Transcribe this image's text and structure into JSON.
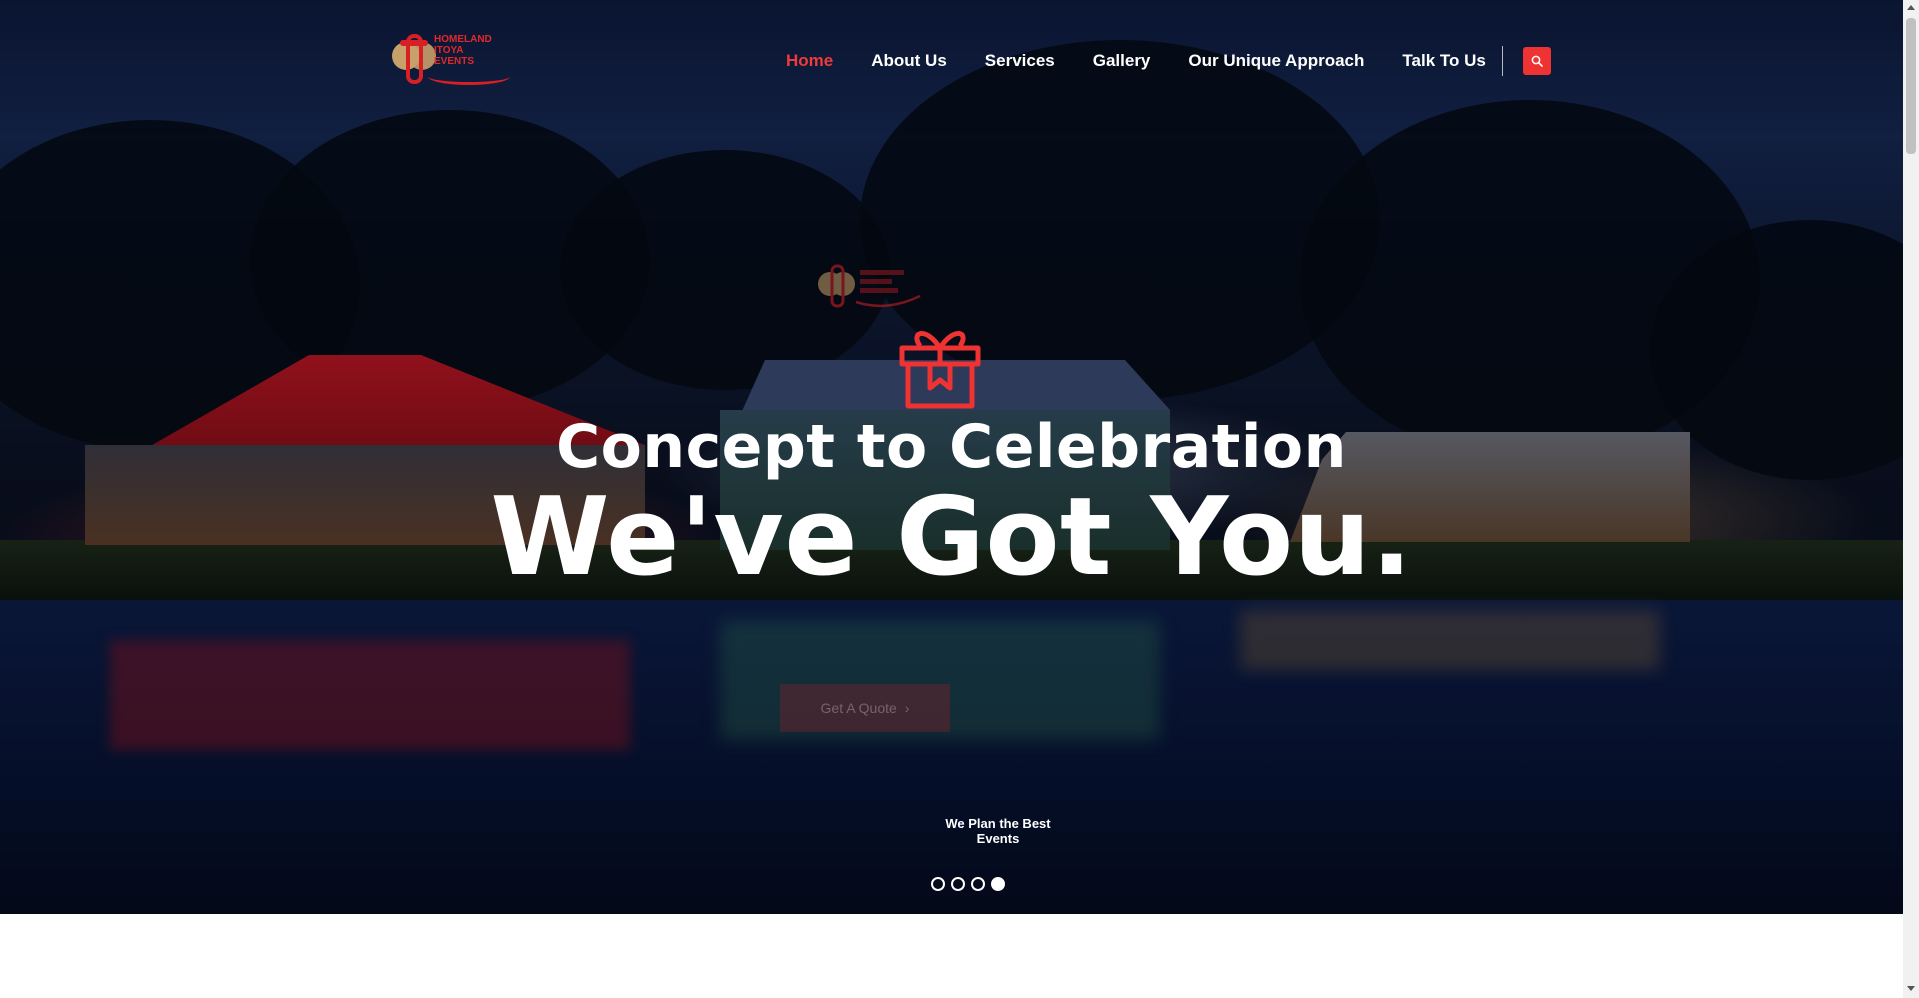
{
  "brand": {
    "logo_lines": [
      "HOMELAND",
      "ITOYA",
      "EVENTS"
    ],
    "accent_color": "#ef3232",
    "logo_red": "#d81f26",
    "logo_gold": "#c8a06a"
  },
  "nav": {
    "items": [
      {
        "label": "Home",
        "active": true
      },
      {
        "label": "About Us",
        "active": false
      },
      {
        "label": "Services",
        "active": false
      },
      {
        "label": "Gallery",
        "active": false
      },
      {
        "label": "Our Unique Approach",
        "active": false
      },
      {
        "label": "Talk To Us",
        "active": false
      }
    ],
    "search_icon": "search-icon"
  },
  "hero": {
    "icon": "gift-icon",
    "heading": "Concept to Celebration",
    "subheading": "We've Got You.",
    "cta_label": "Get A Quote",
    "cta_icon": "chevron-right-icon",
    "tagline": "We Plan the Best Events",
    "slides": {
      "count": 4,
      "active_index": 3
    }
  }
}
